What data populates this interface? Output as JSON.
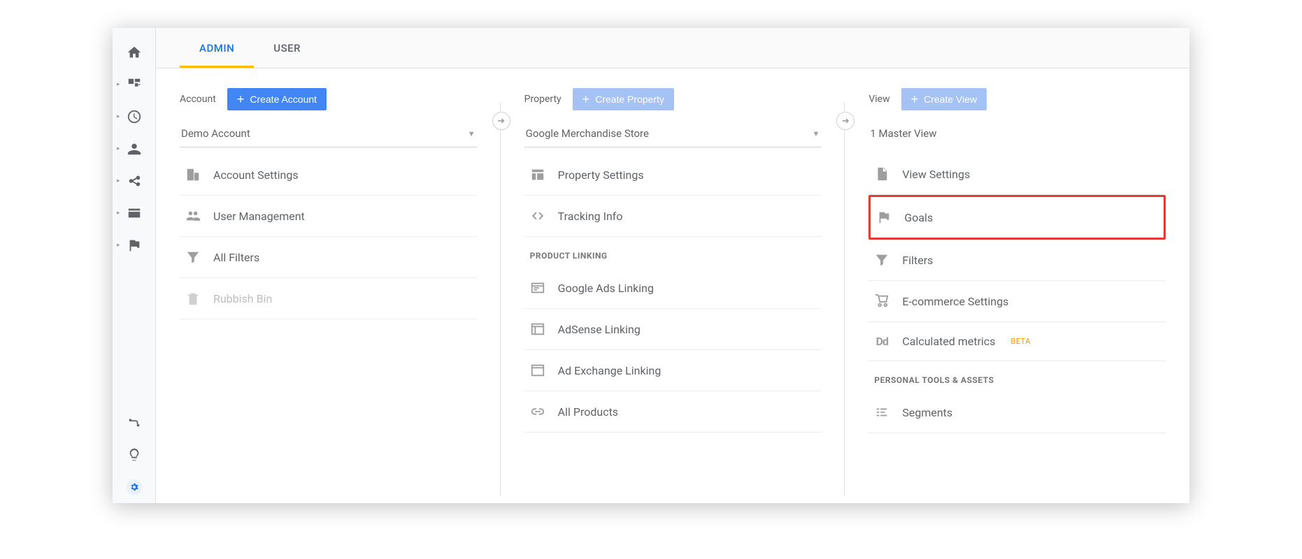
{
  "tabs": {
    "admin": "ADMIN",
    "user": "USER"
  },
  "account": {
    "title": "Account",
    "create": "Create Account",
    "selected": "Demo Account",
    "items": [
      {
        "label": "Account Settings"
      },
      {
        "label": "User Management"
      },
      {
        "label": "All Filters"
      },
      {
        "label": "Rubbish Bin"
      }
    ]
  },
  "property": {
    "title": "Property",
    "create": "Create Property",
    "selected": "Google Merchandise Store",
    "items": [
      {
        "label": "Property Settings"
      },
      {
        "label": "Tracking Info"
      }
    ],
    "section_linking": "PRODUCT LINKING",
    "linking_items": [
      {
        "label": "Google Ads Linking"
      },
      {
        "label": "AdSense Linking"
      },
      {
        "label": "Ad Exchange Linking"
      },
      {
        "label": "All Products"
      }
    ]
  },
  "view": {
    "title": "View",
    "create": "Create View",
    "selected": "1 Master View",
    "items": [
      {
        "label": "View Settings"
      },
      {
        "label": "Goals"
      },
      {
        "label": "Filters"
      },
      {
        "label": "E-commerce Settings"
      },
      {
        "label": "Calculated metrics",
        "badge": "BETA"
      }
    ],
    "section_personal": "PERSONAL TOOLS & ASSETS",
    "personal_items": [
      {
        "label": "Segments"
      }
    ]
  }
}
